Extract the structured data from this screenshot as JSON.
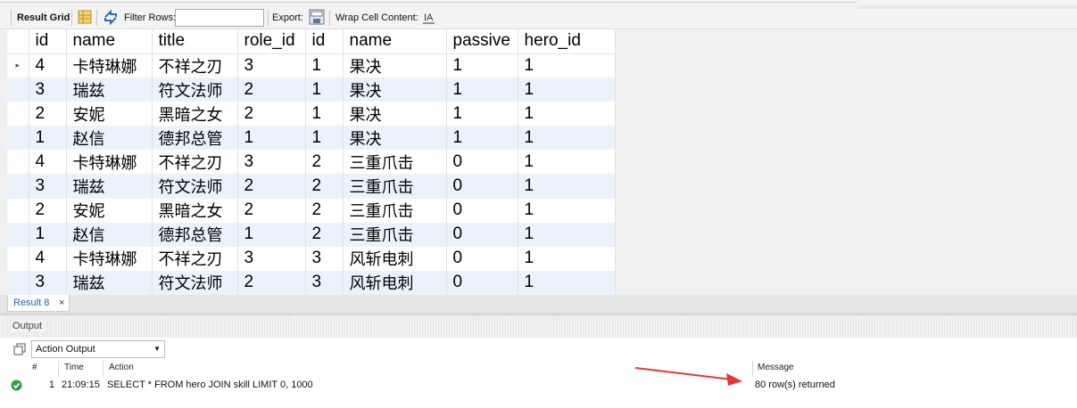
{
  "toolbar": {
    "result_grid_label": "Result Grid",
    "filter_rows_label": "Filter Rows:",
    "filter_rows_value": "",
    "export_label": "Export:",
    "wrap_cell_label": "Wrap Cell Content:"
  },
  "grid": {
    "columns": [
      "id",
      "name",
      "title",
      "role_id",
      "id",
      "name",
      "passive",
      "hero_id"
    ],
    "rows": [
      [
        "4",
        "卡特琳娜",
        "不祥之刃",
        "3",
        "1",
        "果决",
        "1",
        "1"
      ],
      [
        "3",
        "瑞兹",
        "符文法师",
        "2",
        "1",
        "果决",
        "1",
        "1"
      ],
      [
        "2",
        "安妮",
        "黑暗之女",
        "2",
        "1",
        "果决",
        "1",
        "1"
      ],
      [
        "1",
        "赵信",
        "德邦总管",
        "1",
        "1",
        "果决",
        "1",
        "1"
      ],
      [
        "4",
        "卡特琳娜",
        "不祥之刃",
        "3",
        "2",
        "三重爪击",
        "0",
        "1"
      ],
      [
        "3",
        "瑞兹",
        "符文法师",
        "2",
        "2",
        "三重爪击",
        "0",
        "1"
      ],
      [
        "2",
        "安妮",
        "黑暗之女",
        "2",
        "2",
        "三重爪击",
        "0",
        "1"
      ],
      [
        "1",
        "赵信",
        "德邦总管",
        "1",
        "2",
        "三重爪击",
        "0",
        "1"
      ],
      [
        "4",
        "卡特琳娜",
        "不祥之刃",
        "3",
        "3",
        "风斩电刺",
        "0",
        "1"
      ],
      [
        "3",
        "瑞兹",
        "符文法师",
        "2",
        "3",
        "风斩电刺",
        "0",
        "1"
      ]
    ],
    "current_row_marker": "▸"
  },
  "result_tab": {
    "label": "Result 8",
    "close": "×"
  },
  "output": {
    "title": "Output",
    "selector_value": "Action Output",
    "headers": {
      "num": "#",
      "time": "Time",
      "action": "Action",
      "message": "Message"
    },
    "entry": {
      "num": "1",
      "time": "21:09:15",
      "action": "SELECT * FROM hero JOIN skill LIMIT 0, 1000",
      "message": "80 row(s) returned"
    }
  },
  "colors": {
    "row_alt": "#eaf2fb",
    "accent_arrow": "#e53935",
    "ok_green": "#2e9e3a",
    "tab_text": "#1a5fb4"
  }
}
